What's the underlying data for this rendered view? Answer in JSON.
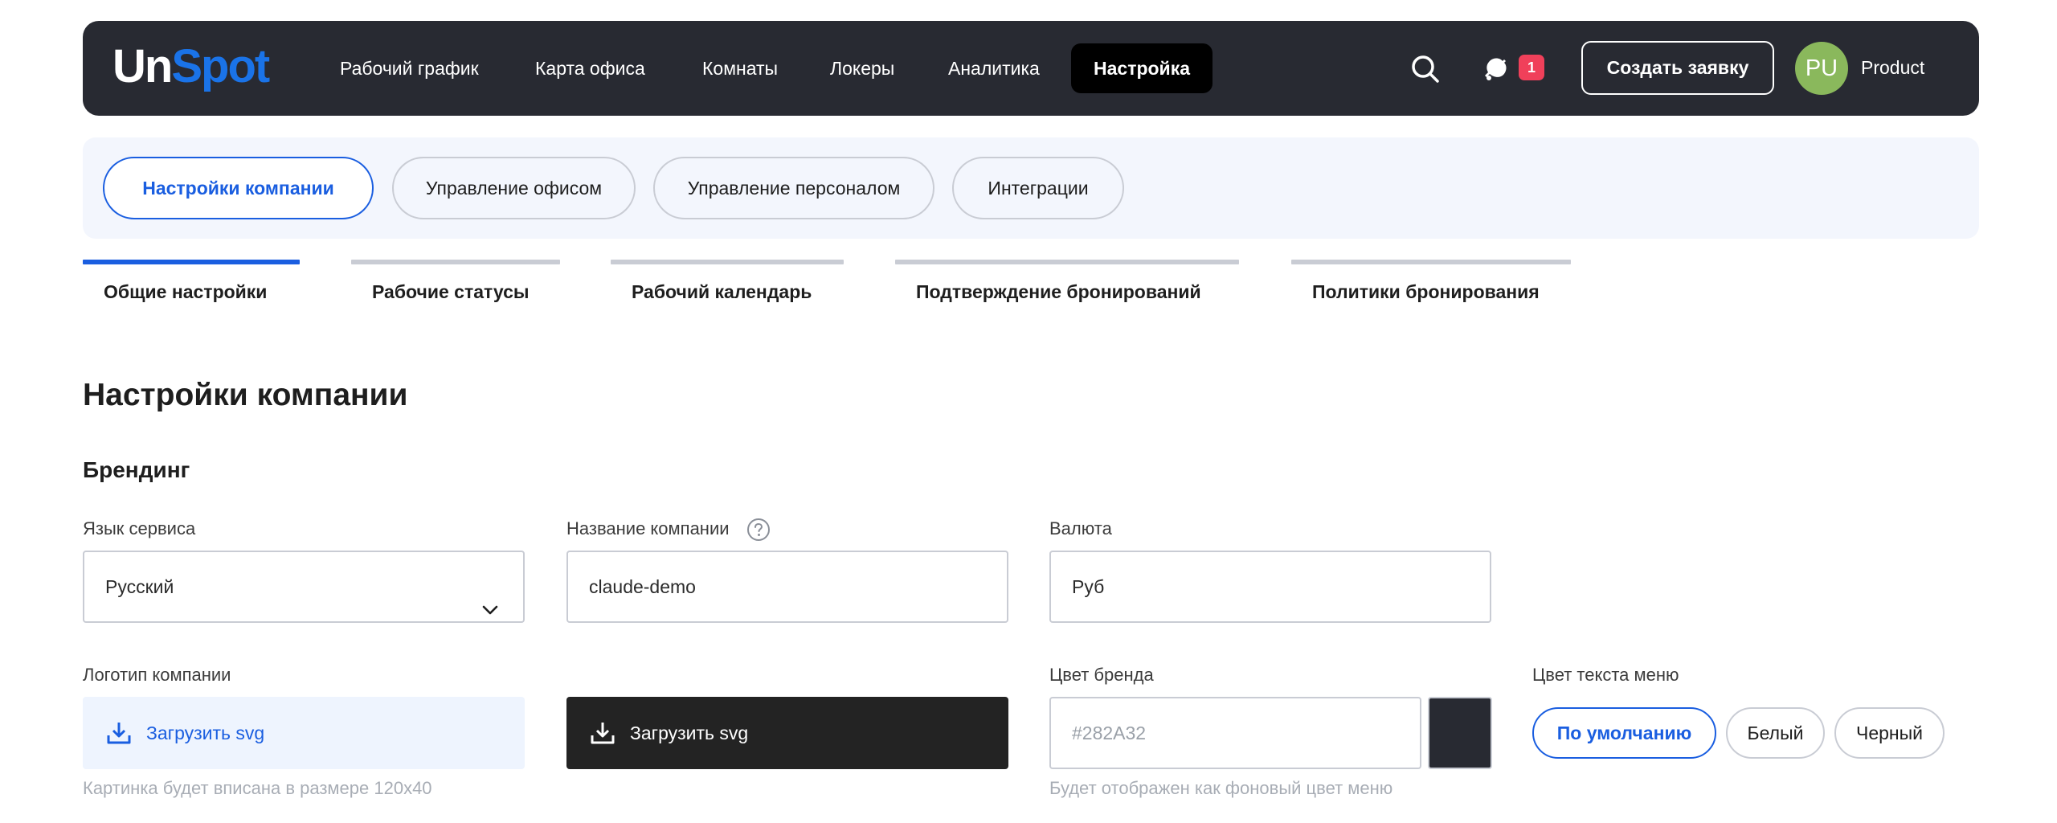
{
  "brand": {
    "logo_part1": "Un",
    "logo_part2": "Spot",
    "accent": "#1a5ee0",
    "nav_bg": "#282a32"
  },
  "nav": {
    "items": [
      {
        "label": "Рабочий график"
      },
      {
        "label": "Карта офиса"
      },
      {
        "label": "Комнаты"
      },
      {
        "label": "Локеры"
      },
      {
        "label": "Аналитика"
      },
      {
        "label": "Настройка",
        "active": true
      }
    ],
    "search_icon": "search-icon",
    "notification_icon": "bell-icon",
    "notification_count": "1",
    "create_button": "Создать заявку",
    "avatar_initials": "PU",
    "user_name": "Product"
  },
  "sections": {
    "pills": [
      {
        "label": "Настройки компании",
        "active": true
      },
      {
        "label": "Управление офисом"
      },
      {
        "label": "Управление персоналом"
      },
      {
        "label": "Интеграции"
      }
    ]
  },
  "subtabs": [
    {
      "label": "Общие настройки",
      "active": true
    },
    {
      "label": "Рабочие статусы"
    },
    {
      "label": "Рабочий календарь"
    },
    {
      "label": "Подтверждение бронирований"
    },
    {
      "label": "Политики бронирования"
    }
  ],
  "page": {
    "title": "Настройки компании",
    "branding_title": "Брендинг",
    "language": {
      "label": "Язык сервиса",
      "value": "Русский"
    },
    "company_name": {
      "label": "Название компании",
      "value": "claude-demo"
    },
    "currency": {
      "label": "Валюта",
      "value": "Руб"
    },
    "logo": {
      "label": "Логотип компании",
      "upload_light": "Загрузить svg",
      "upload_dark": "Загрузить svg",
      "hint": "Картинка будет вписана в размере 120x40"
    },
    "brand_color": {
      "label": "Цвет бренда",
      "placeholder": "#282A32",
      "swatch": "#282a32",
      "hint": "Будет отображен как фоновый цвет меню"
    },
    "menu_text_color": {
      "label": "Цвет текста меню",
      "options": [
        {
          "label": "По умолчанию",
          "active": true
        },
        {
          "label": "Белый"
        },
        {
          "label": "Черный"
        }
      ]
    }
  }
}
